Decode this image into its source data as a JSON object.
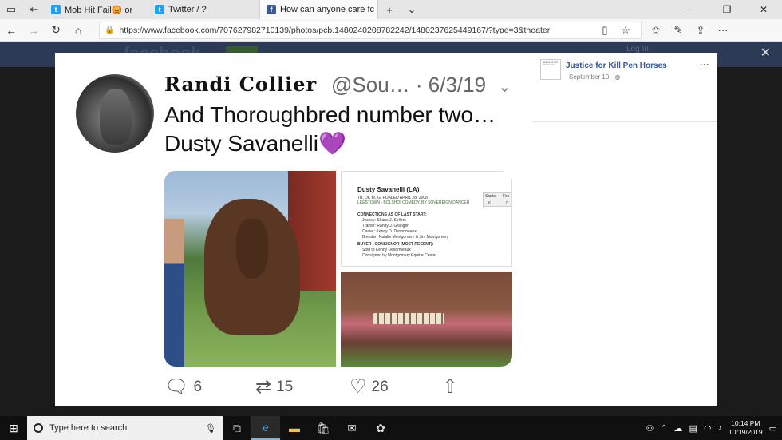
{
  "browser": {
    "tabs": [
      {
        "title": "Mob Hit Fail😡 or",
        "active": false,
        "favicon_color": "#1da1f2"
      },
      {
        "title": "Twitter / ?",
        "active": false,
        "favicon_color": "#1da1f2"
      },
      {
        "title": "How can anyone care fc",
        "active": true,
        "favicon_color": "#3b5998"
      }
    ],
    "url": "https://www.facebook.com/707627982710139/photos/pcb.1480240208782242/1480237625449167/?type=3&theater"
  },
  "facebook": {
    "login_text": "Log In"
  },
  "tweet": {
    "name": "Randi Collier",
    "handle": "@Sou…",
    "date": "6/3/19",
    "text_line1": "And Thoroughbred number two…",
    "text_line2": "Dusty Savanelli",
    "emoji": "💜",
    "replies": "6",
    "retweets": "15",
    "likes": "26",
    "document": {
      "title": "Dusty Savanelli (LA)",
      "line1": "TB, DK B/, G, FOALED APRIL 28, 2008",
      "line2": "LEESTOWN - BOLSHOI COMEDY, BY SOVEREIGN DANCER",
      "connections_label": "CONNECTIONS AS OF LAST START:",
      "jockey": "Jockey: Shane J. Sellers",
      "trainer": "Trainer: Randy J. Granger",
      "owner": "Owner: Kenny D. Desormeaux",
      "breeder": "Breeder: Natalie Montgomery & Jim Montgomery",
      "buyer_label": "BUYER / CONSIGNOR (MOST RECENT):",
      "sold": "Sold to Kenny Desormeaux",
      "consigned": "Consigned by Montgomery Equine Center",
      "starts_label": "Starts",
      "starts_value": "6",
      "first_label": "Firs",
      "first_value": "0"
    }
  },
  "post": {
    "page_name": "Justice for Kill Pen Horses",
    "date": "September 10 · ",
    "more": "···"
  },
  "taskbar": {
    "search_placeholder": "Type here to search",
    "time": "10:14 PM",
    "date": "10/19/2019"
  }
}
